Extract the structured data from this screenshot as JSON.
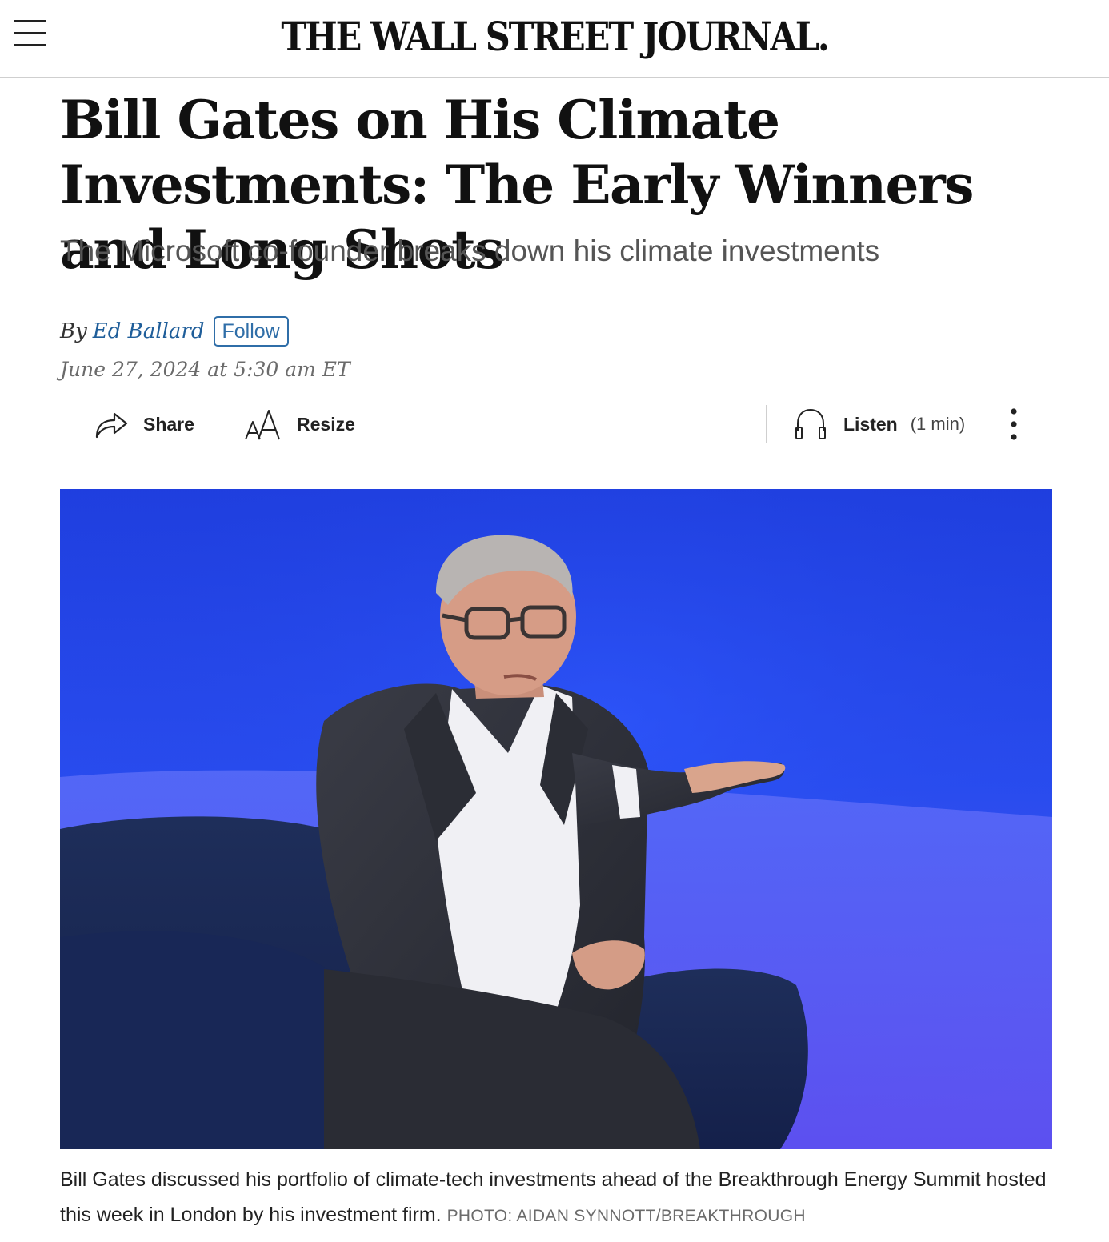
{
  "header": {
    "masthead": "THE WALL STREET JOURNAL."
  },
  "article": {
    "headline": "Bill Gates on His Climate Investments: The Early Winners and Long Shots",
    "dek": "The Microsoft co-founder breaks down his climate investments",
    "byline": {
      "prefix": "By",
      "author": "Ed Ballard",
      "follow_label": "Follow"
    },
    "date": "June 27, 2024 at 5:30 am ET"
  },
  "toolbar": {
    "share_label": "Share",
    "resize_label": "Resize",
    "listen_label": "Listen",
    "listen_duration": "(1 min)",
    "icons": [
      "share-icon",
      "resize-icon",
      "headphones-icon",
      "more-icon"
    ]
  },
  "photo": {
    "caption": "Bill Gates discussed his portfolio of climate-tech investments ahead of the Breakthrough Energy Summit hosted this week in London by his investment firm.",
    "credit": "PHOTO: AIDAN SYNNOTT/BREAKTHROUGH"
  },
  "colors": {
    "link": "#1f5e9a",
    "photo_background": "#2a4ef2",
    "text": "#111111",
    "muted": "#6b6b6b"
  }
}
